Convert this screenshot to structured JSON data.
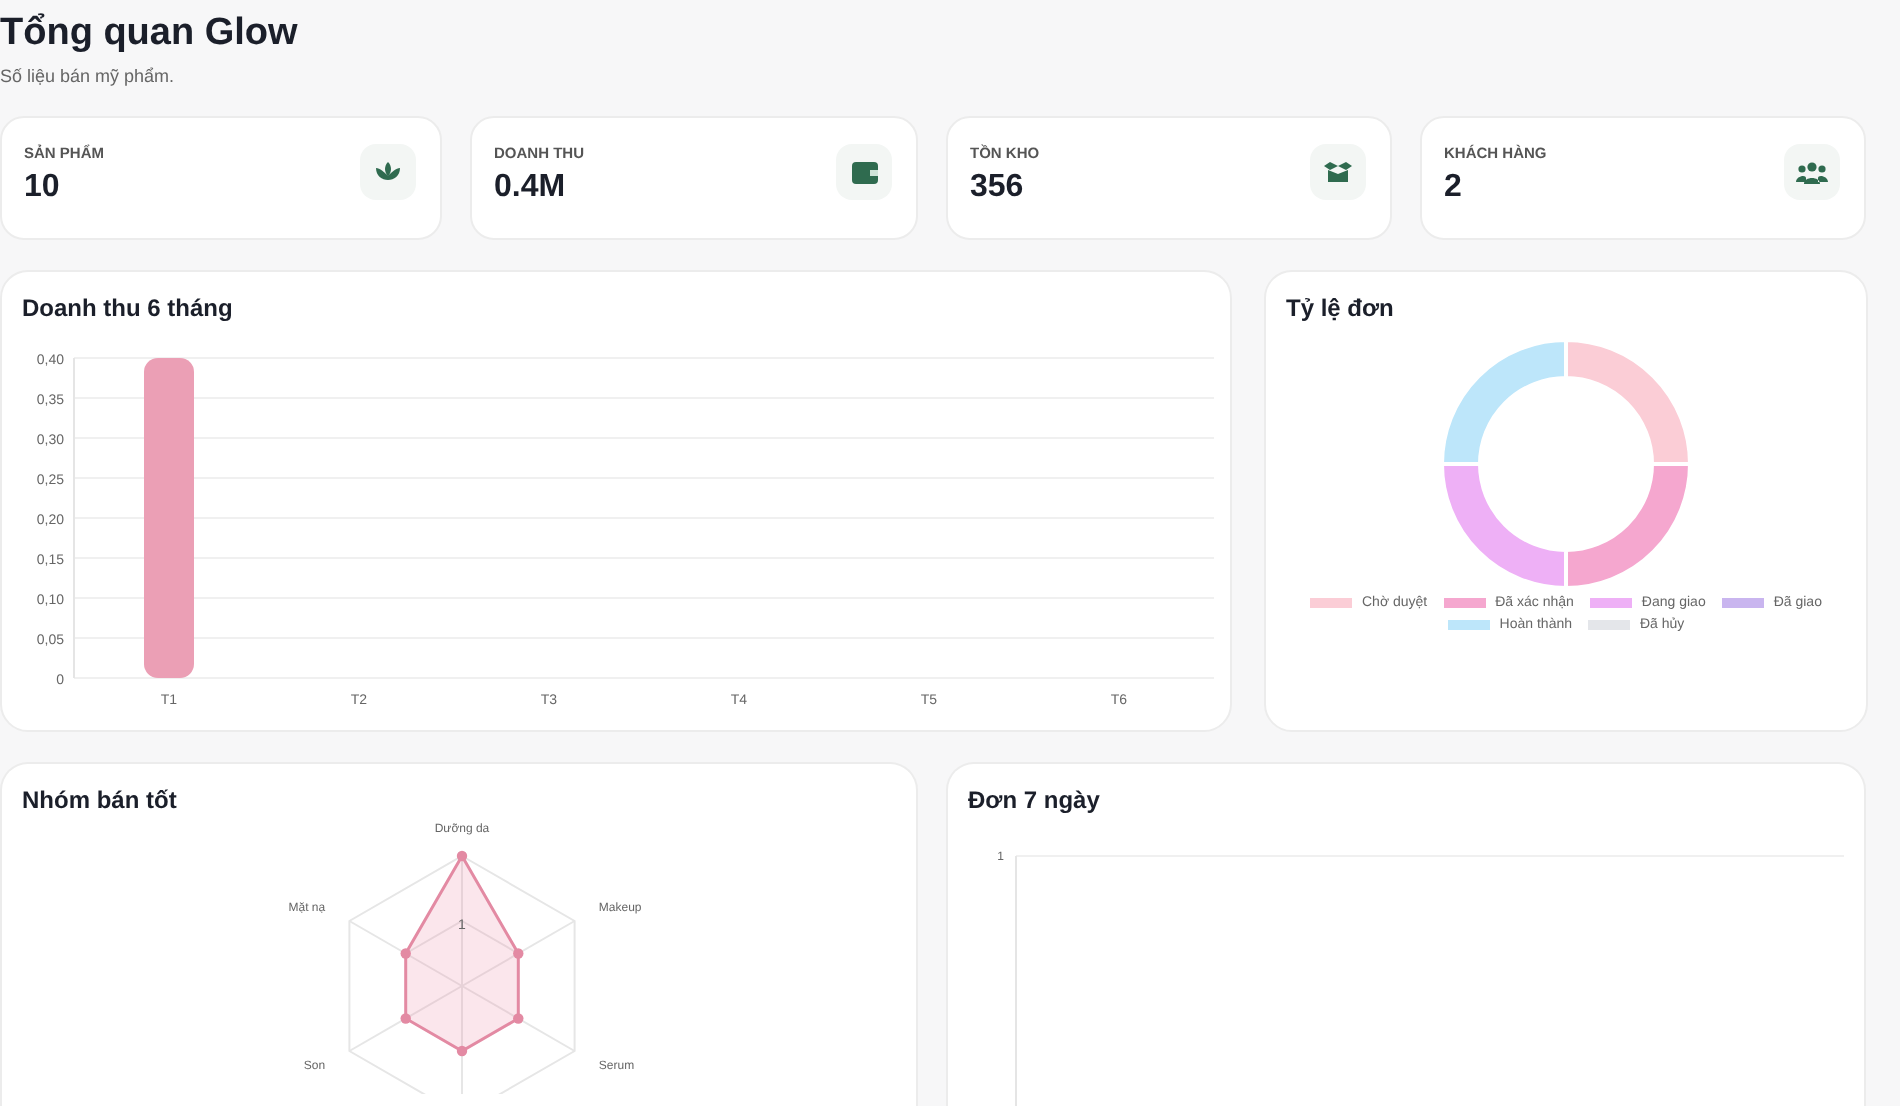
{
  "header": {
    "title": "Tổng quan Glow",
    "subtitle": "Số liệu bán mỹ phẩm."
  },
  "stats": [
    {
      "label": "SẢN PHẨM",
      "value": "10"
    },
    {
      "label": "DOANH THU",
      "value": "0.4M"
    },
    {
      "label": "TỒN KHO",
      "value": "356"
    },
    {
      "label": "KHÁCH HÀNG",
      "value": "2"
    }
  ],
  "revenue": {
    "title": "Doanh thu 6 tháng",
    "chart_data": {
      "type": "bar",
      "grid": true,
      "categories": [
        "T1",
        "T2",
        "T3",
        "T4",
        "T5",
        "T6"
      ],
      "series": [
        {
          "color": "#eb9fb5",
          "values": [
            0.4,
            0,
            0,
            0,
            0,
            0
          ]
        }
      ],
      "ylim": [
        0,
        0.4
      ],
      "yticks": [
        {
          "value": 0,
          "label": "0"
        },
        {
          "value": 0.05,
          "label": "0,05"
        },
        {
          "value": 0.1,
          "label": "0,10"
        },
        {
          "value": 0.15,
          "label": "0,15"
        },
        {
          "value": 0.2,
          "label": "0,20"
        },
        {
          "value": 0.25,
          "label": "0,25"
        },
        {
          "value": 0.3,
          "label": "0,30"
        },
        {
          "value": 0.35,
          "label": "0,35"
        },
        {
          "value": 0.4,
          "label": "0,40"
        }
      ]
    }
  },
  "orders_ratio": {
    "title": "Tỷ lệ đơn",
    "chart_data": {
      "type": "donut",
      "legend": true,
      "categories": [
        "Chờ duyệt",
        "Đã xác nhận",
        "Đang giao",
        "Đã giao",
        "Hoàn thành",
        "Đã hủy"
      ],
      "series": [
        {
          "colors": [
            "#fbcdd6",
            "#f5a7cf",
            "#eeb0f6",
            "#c9b5ef",
            "#bde6fa",
            "#e4e6ea"
          ],
          "values": [
            25,
            25,
            25,
            0,
            25,
            0
          ]
        }
      ]
    }
  },
  "top_groups": {
    "title": "Nhóm bán tốt",
    "scale_label": "1",
    "axis_labels": [
      "Dưỡng da",
      "Makeup",
      "Serum",
      "Son",
      "Mặt nạ"
    ]
  },
  "orders_week": {
    "title": "Đơn 7 ngày",
    "y_tick": "1"
  }
}
